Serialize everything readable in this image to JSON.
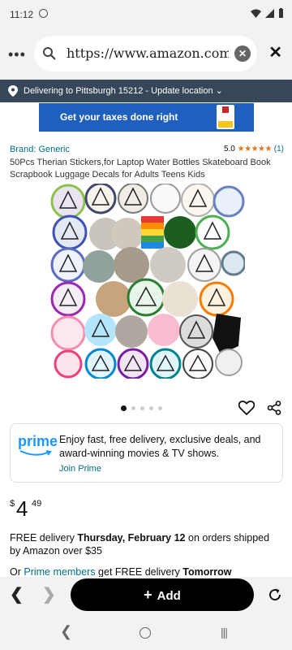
{
  "status_bar": {
    "time": "11:12"
  },
  "browser": {
    "menu_icon": "more-horizontal-icon",
    "url": "https://www.amazon.com",
    "close_icon": "close-icon"
  },
  "delivery_bar": {
    "text": "Delivering to Pittsburgh 15212 - Update location ⌄"
  },
  "ad": {
    "text": "Get your taxes done right"
  },
  "product": {
    "brand": "Brand: Generic",
    "rating_value": "5.0",
    "rating_stars": "★★★★★",
    "rating_count": "(1)",
    "title": "50Pcs Therian Stickers,for Laptop Water Bottles Skateboard Book Scrapbook Luggage Decals for Adults Teens Kids",
    "image_count": 5,
    "active_image": 1
  },
  "prime": {
    "logo": "prime",
    "description": "Enjoy fast, free delivery, exclusive deals, and award-winning movies & TV shows.",
    "join": "Join Prime"
  },
  "price": {
    "symbol": "$",
    "whole": "4",
    "fraction": "49"
  },
  "delivery": {
    "prefix": "FREE delivery ",
    "date": "Thursday, February 12",
    "suffix": " on orders shipped by Amazon over $35",
    "members_prefix": "Or ",
    "members_link": "Prime members",
    "members_suffix": " get FREE delivery ",
    "members_date": "Tomorrow"
  },
  "bottom_bar": {
    "add_label": "Add",
    "add_icon": "+"
  },
  "colors": {
    "accent_link": "#007185",
    "delivery_bar_bg": "#37475a",
    "prime_blue": "#1a98ff",
    "star": "#de7921",
    "ad_bg": "#1f5fbe"
  }
}
